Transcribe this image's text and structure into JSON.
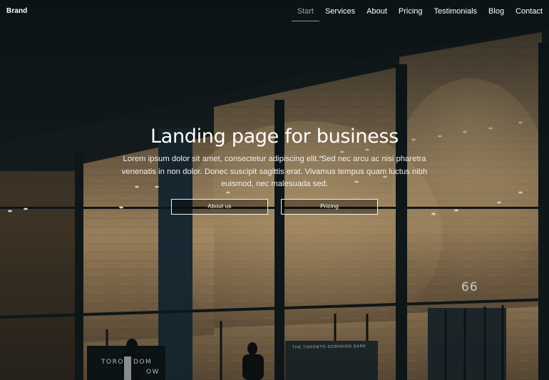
{
  "brand": "Brand",
  "nav": {
    "items": [
      {
        "label": "Start",
        "active": true
      },
      {
        "label": "Services",
        "active": false
      },
      {
        "label": "About",
        "active": false
      },
      {
        "label": "Pricing",
        "active": false
      },
      {
        "label": "Testimonials",
        "active": false
      },
      {
        "label": "Blog",
        "active": false
      },
      {
        "label": "Contact",
        "active": false
      }
    ]
  },
  "hero": {
    "title": "Landing page for business",
    "text": "Lorem ipsum dolor sit amet, consectetur adipiscing elit. Sed nec arcu ac nisi pharetra venenatis in non dolor. Donec suscipit sagittis erat. Vivamus tempus quam luctus nibh euismod, nec malesuada sed.",
    "buttons": {
      "about": "About us",
      "pricing": "Pricing"
    }
  },
  "background": {
    "building_number": "66",
    "sign_left": "TORO   DOM",
    "sign_left_line2": "OW",
    "sign_bank": "THE TORONTO-DOMINION BANK"
  },
  "colors": {
    "background": "#0e1518",
    "stone_warm": "#a88a62",
    "nav_active": "#9aa3a6",
    "text": "#ffffff"
  }
}
